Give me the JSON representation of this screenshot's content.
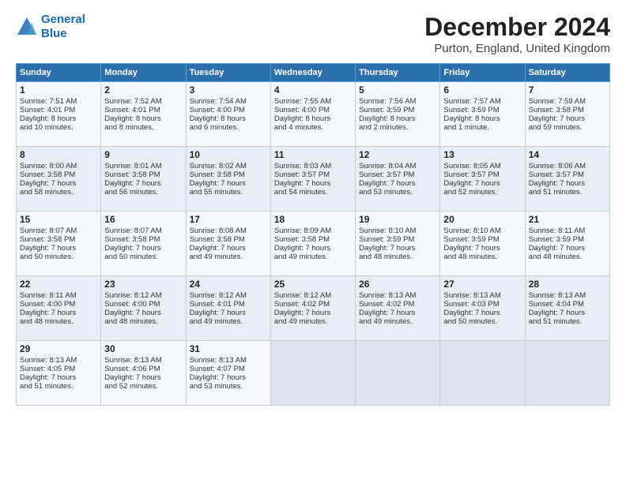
{
  "header": {
    "logo_line1": "General",
    "logo_line2": "Blue",
    "title": "December 2024",
    "subtitle": "Purton, England, United Kingdom"
  },
  "weekdays": [
    "Sunday",
    "Monday",
    "Tuesday",
    "Wednesday",
    "Thursday",
    "Friday",
    "Saturday"
  ],
  "weeks": [
    [
      {
        "day": "1",
        "lines": [
          "Sunrise: 7:51 AM",
          "Sunset: 4:01 PM",
          "Daylight: 8 hours",
          "and 10 minutes."
        ]
      },
      {
        "day": "2",
        "lines": [
          "Sunrise: 7:52 AM",
          "Sunset: 4:01 PM",
          "Daylight: 8 hours",
          "and 8 minutes."
        ]
      },
      {
        "day": "3",
        "lines": [
          "Sunrise: 7:54 AM",
          "Sunset: 4:00 PM",
          "Daylight: 8 hours",
          "and 6 minutes."
        ]
      },
      {
        "day": "4",
        "lines": [
          "Sunrise: 7:55 AM",
          "Sunset: 4:00 PM",
          "Daylight: 8 hours",
          "and 4 minutes."
        ]
      },
      {
        "day": "5",
        "lines": [
          "Sunrise: 7:56 AM",
          "Sunset: 3:59 PM",
          "Daylight: 8 hours",
          "and 2 minutes."
        ]
      },
      {
        "day": "6",
        "lines": [
          "Sunrise: 7:57 AM",
          "Sunset: 3:59 PM",
          "Daylight: 8 hours",
          "and 1 minute."
        ]
      },
      {
        "day": "7",
        "lines": [
          "Sunrise: 7:59 AM",
          "Sunset: 3:58 PM",
          "Daylight: 7 hours",
          "and 59 minutes."
        ]
      }
    ],
    [
      {
        "day": "8",
        "lines": [
          "Sunrise: 8:00 AM",
          "Sunset: 3:58 PM",
          "Daylight: 7 hours",
          "and 58 minutes."
        ]
      },
      {
        "day": "9",
        "lines": [
          "Sunrise: 8:01 AM",
          "Sunset: 3:58 PM",
          "Daylight: 7 hours",
          "and 56 minutes."
        ]
      },
      {
        "day": "10",
        "lines": [
          "Sunrise: 8:02 AM",
          "Sunset: 3:58 PM",
          "Daylight: 7 hours",
          "and 55 minutes."
        ]
      },
      {
        "day": "11",
        "lines": [
          "Sunrise: 8:03 AM",
          "Sunset: 3:57 PM",
          "Daylight: 7 hours",
          "and 54 minutes."
        ]
      },
      {
        "day": "12",
        "lines": [
          "Sunrise: 8:04 AM",
          "Sunset: 3:57 PM",
          "Daylight: 7 hours",
          "and 53 minutes."
        ]
      },
      {
        "day": "13",
        "lines": [
          "Sunrise: 8:05 AM",
          "Sunset: 3:57 PM",
          "Daylight: 7 hours",
          "and 52 minutes."
        ]
      },
      {
        "day": "14",
        "lines": [
          "Sunrise: 8:06 AM",
          "Sunset: 3:57 PM",
          "Daylight: 7 hours",
          "and 51 minutes."
        ]
      }
    ],
    [
      {
        "day": "15",
        "lines": [
          "Sunrise: 8:07 AM",
          "Sunset: 3:58 PM",
          "Daylight: 7 hours",
          "and 50 minutes."
        ]
      },
      {
        "day": "16",
        "lines": [
          "Sunrise: 8:07 AM",
          "Sunset: 3:58 PM",
          "Daylight: 7 hours",
          "and 50 minutes."
        ]
      },
      {
        "day": "17",
        "lines": [
          "Sunrise: 8:08 AM",
          "Sunset: 3:58 PM",
          "Daylight: 7 hours",
          "and 49 minutes."
        ]
      },
      {
        "day": "18",
        "lines": [
          "Sunrise: 8:09 AM",
          "Sunset: 3:58 PM",
          "Daylight: 7 hours",
          "and 49 minutes."
        ]
      },
      {
        "day": "19",
        "lines": [
          "Sunrise: 8:10 AM",
          "Sunset: 3:59 PM",
          "Daylight: 7 hours",
          "and 48 minutes."
        ]
      },
      {
        "day": "20",
        "lines": [
          "Sunrise: 8:10 AM",
          "Sunset: 3:59 PM",
          "Daylight: 7 hours",
          "and 48 minutes."
        ]
      },
      {
        "day": "21",
        "lines": [
          "Sunrise: 8:11 AM",
          "Sunset: 3:59 PM",
          "Daylight: 7 hours",
          "and 48 minutes."
        ]
      }
    ],
    [
      {
        "day": "22",
        "lines": [
          "Sunrise: 8:11 AM",
          "Sunset: 4:00 PM",
          "Daylight: 7 hours",
          "and 48 minutes."
        ]
      },
      {
        "day": "23",
        "lines": [
          "Sunrise: 8:12 AM",
          "Sunset: 4:00 PM",
          "Daylight: 7 hours",
          "and 48 minutes."
        ]
      },
      {
        "day": "24",
        "lines": [
          "Sunrise: 8:12 AM",
          "Sunset: 4:01 PM",
          "Daylight: 7 hours",
          "and 49 minutes."
        ]
      },
      {
        "day": "25",
        "lines": [
          "Sunrise: 8:12 AM",
          "Sunset: 4:02 PM",
          "Daylight: 7 hours",
          "and 49 minutes."
        ]
      },
      {
        "day": "26",
        "lines": [
          "Sunrise: 8:13 AM",
          "Sunset: 4:02 PM",
          "Daylight: 7 hours",
          "and 49 minutes."
        ]
      },
      {
        "day": "27",
        "lines": [
          "Sunrise: 8:13 AM",
          "Sunset: 4:03 PM",
          "Daylight: 7 hours",
          "and 50 minutes."
        ]
      },
      {
        "day": "28",
        "lines": [
          "Sunrise: 8:13 AM",
          "Sunset: 4:04 PM",
          "Daylight: 7 hours",
          "and 51 minutes."
        ]
      }
    ],
    [
      {
        "day": "29",
        "lines": [
          "Sunrise: 8:13 AM",
          "Sunset: 4:05 PM",
          "Daylight: 7 hours",
          "and 51 minutes."
        ]
      },
      {
        "day": "30",
        "lines": [
          "Sunrise: 8:13 AM",
          "Sunset: 4:06 PM",
          "Daylight: 7 hours",
          "and 52 minutes."
        ]
      },
      {
        "day": "31",
        "lines": [
          "Sunrise: 8:13 AM",
          "Sunset: 4:07 PM",
          "Daylight: 7 hours",
          "and 53 minutes."
        ]
      },
      null,
      null,
      null,
      null
    ]
  ]
}
